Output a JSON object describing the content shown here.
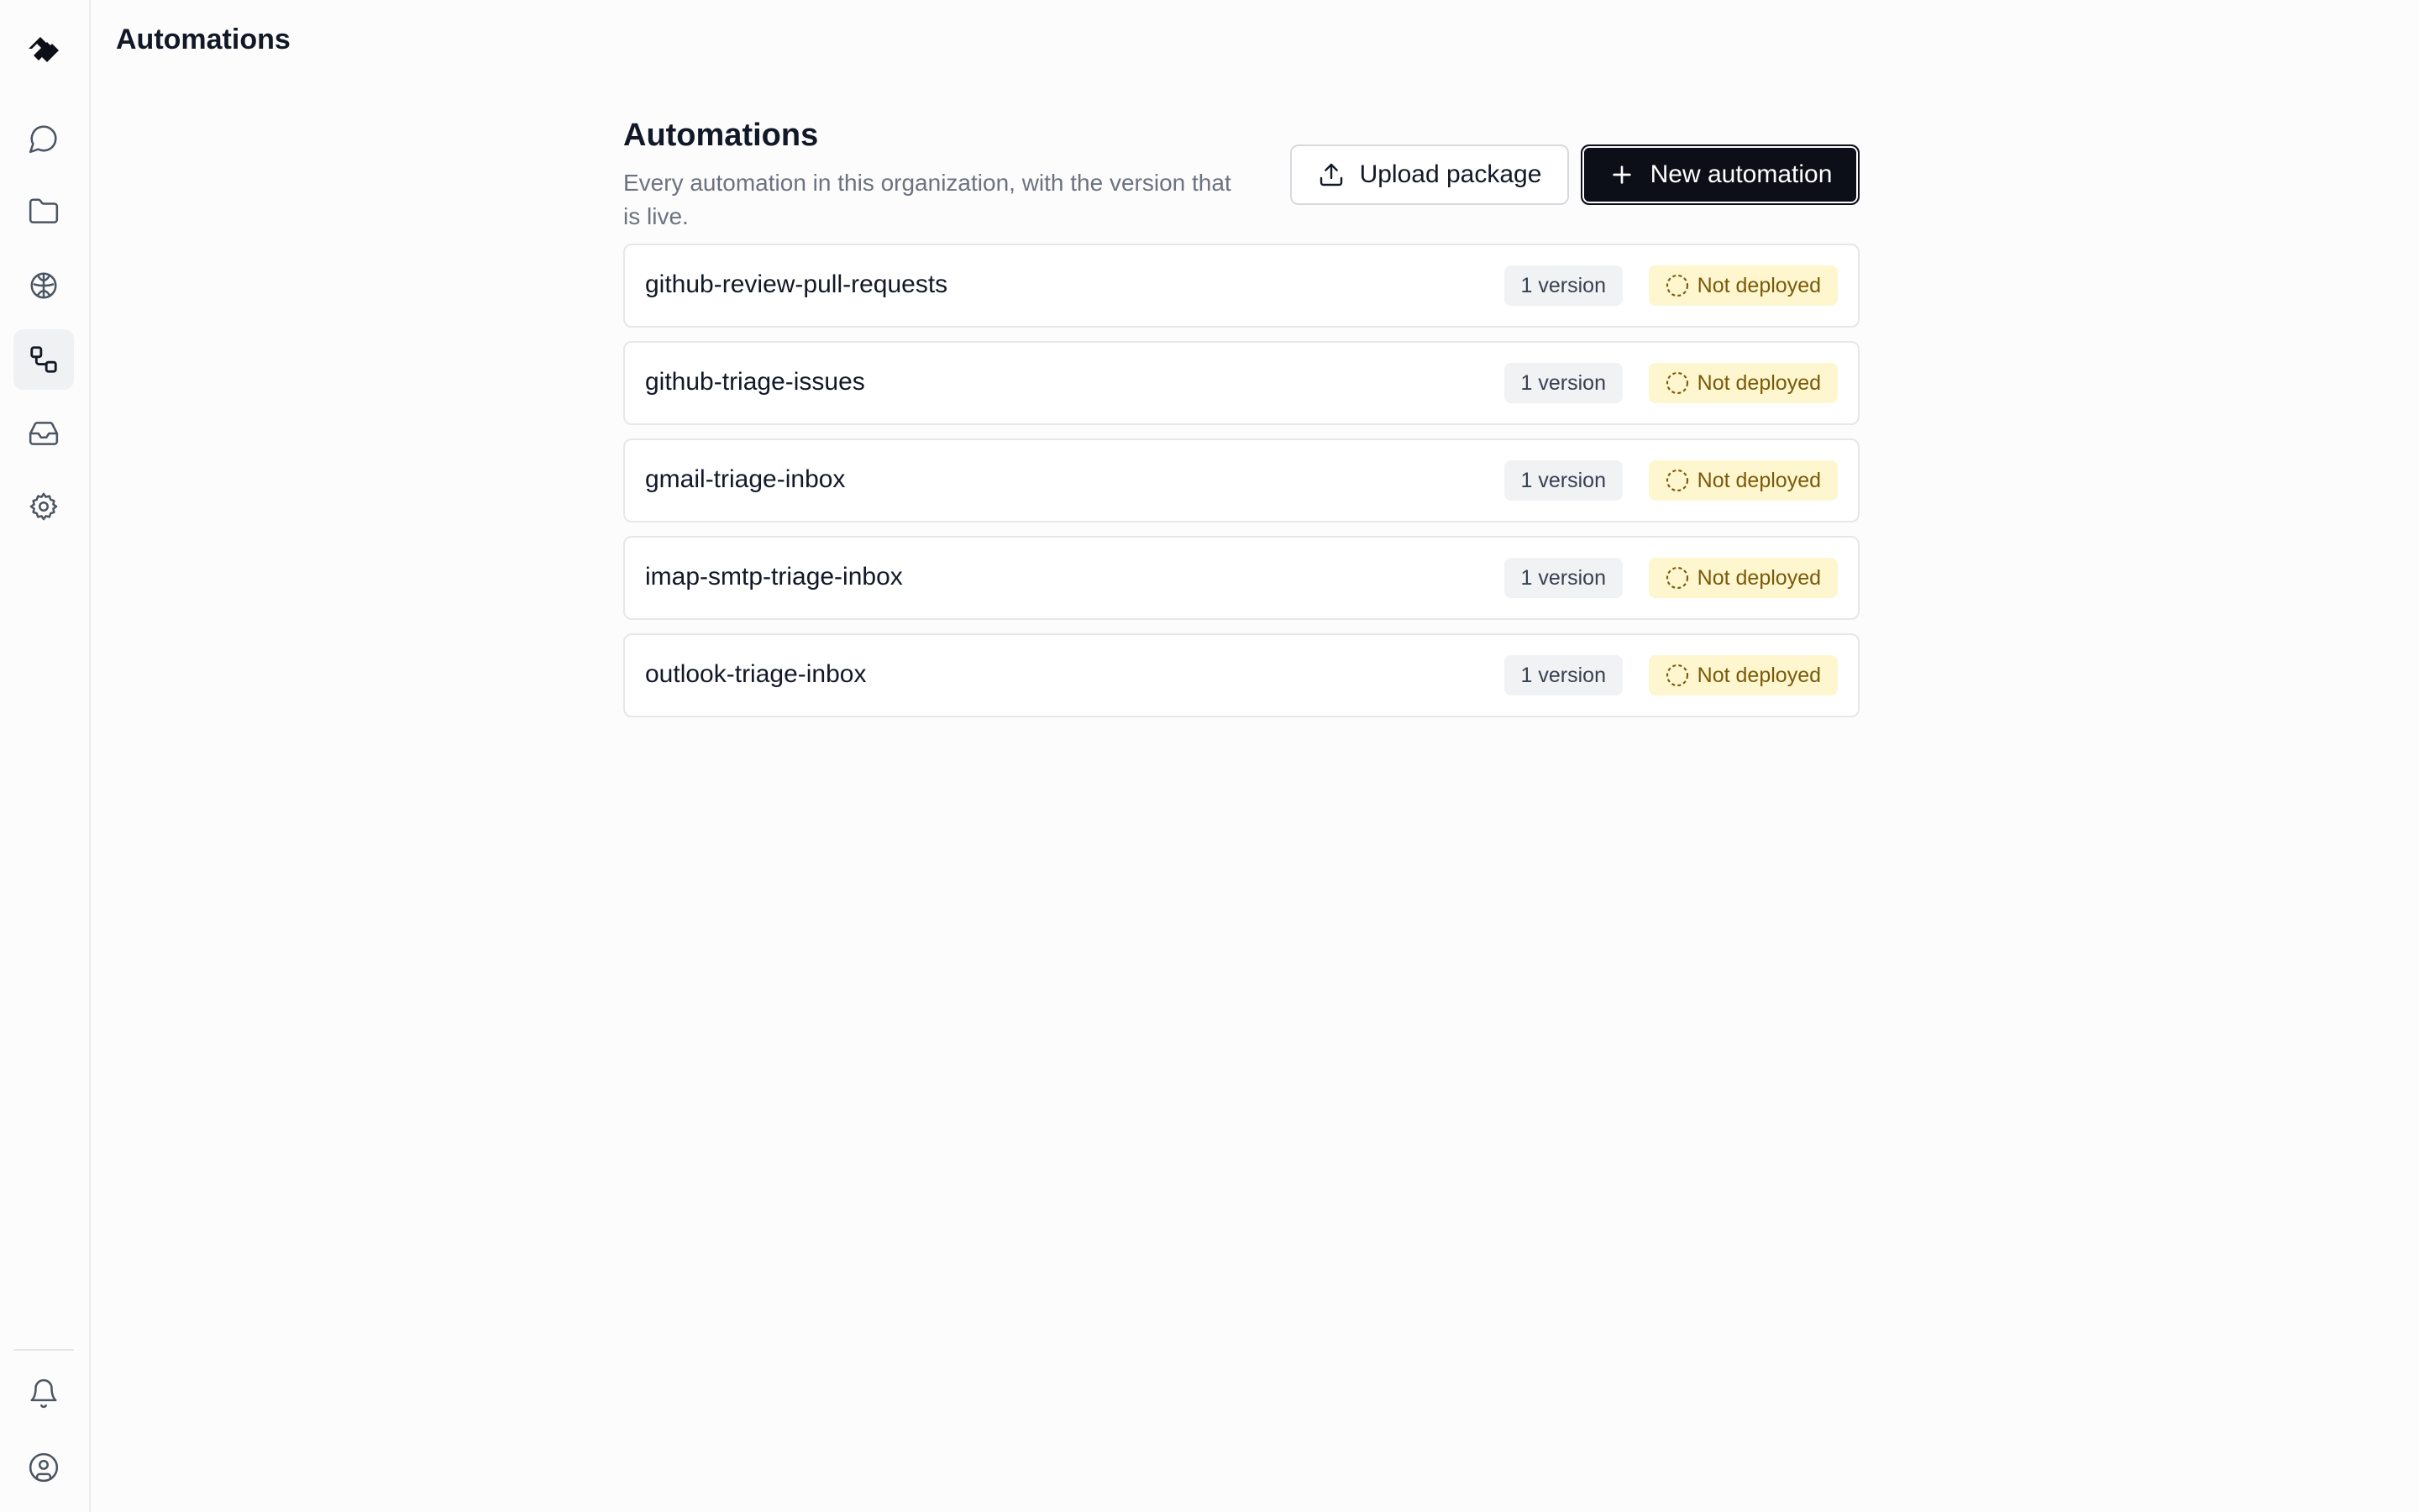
{
  "topbar": {
    "title": "Automations"
  },
  "sidebar": {
    "items": [
      {
        "name": "chat",
        "icon": "chat-bubble-icon",
        "active": false
      },
      {
        "name": "files",
        "icon": "folder-icon",
        "active": false
      },
      {
        "name": "knowledge",
        "icon": "brain-icon",
        "active": false
      },
      {
        "name": "automations",
        "icon": "workflow-icon",
        "active": true
      },
      {
        "name": "inbox",
        "icon": "inbox-icon",
        "active": false
      },
      {
        "name": "settings",
        "icon": "gear-icon",
        "active": false
      }
    ],
    "bottom_items": [
      {
        "name": "notifications",
        "icon": "bell-icon"
      },
      {
        "name": "account",
        "icon": "user-circle-icon"
      }
    ]
  },
  "main": {
    "title": "Automations",
    "subtitle": "Every automation in this organization, with the version that is live.",
    "upload_label": "Upload package",
    "new_label": "New automation",
    "automations": [
      {
        "name": "github-review-pull-requests",
        "versions": "1 version",
        "status": "Not deployed"
      },
      {
        "name": "github-triage-issues",
        "versions": "1 version",
        "status": "Not deployed"
      },
      {
        "name": "gmail-triage-inbox",
        "versions": "1 version",
        "status": "Not deployed"
      },
      {
        "name": "imap-smtp-triage-inbox",
        "versions": "1 version",
        "status": "Not deployed"
      },
      {
        "name": "outlook-triage-inbox",
        "versions": "1 version",
        "status": "Not deployed"
      }
    ]
  },
  "colors": {
    "primary_button": "#0c0f17",
    "status_bg": "#fdf6cf",
    "status_text": "#7a5a0a",
    "badge_bg": "#f1f2f4"
  }
}
